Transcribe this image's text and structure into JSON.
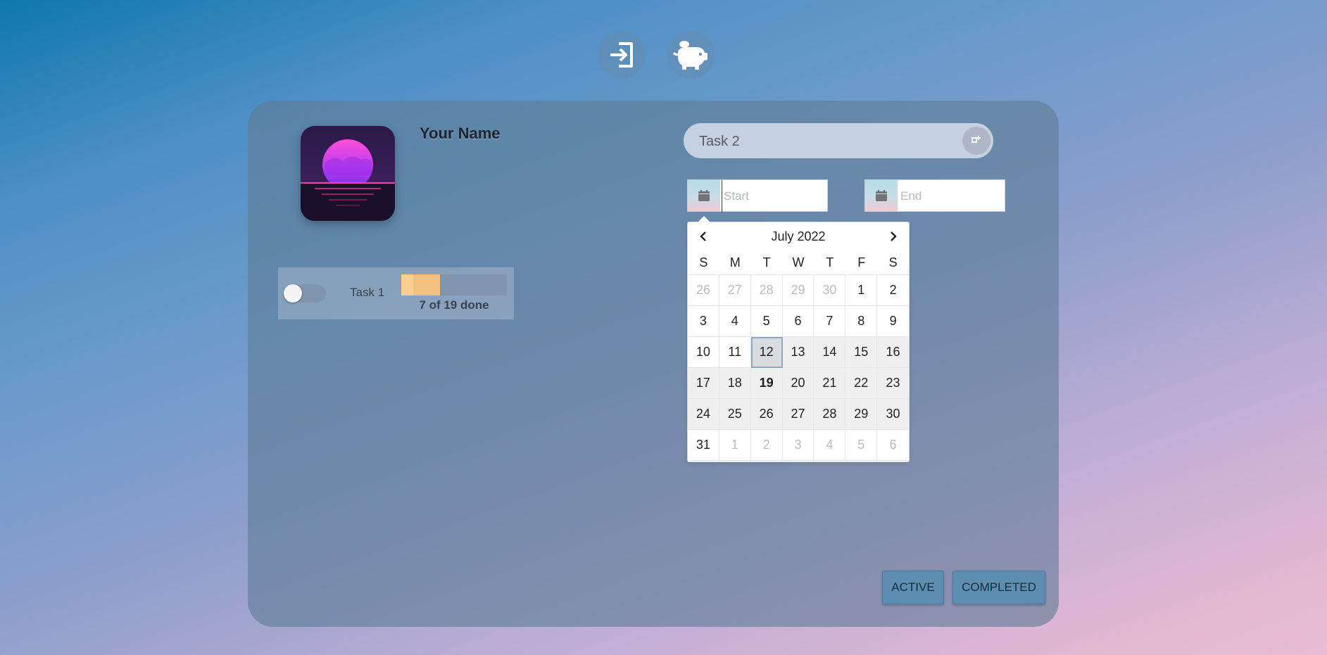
{
  "header": {
    "login_icon": "login-arrow-icon",
    "savings_icon": "piggy-bank-icon"
  },
  "profile": {
    "name": "Your Name",
    "avatar_icon": "synthwave-sunset-avatar"
  },
  "tasks": [
    {
      "name": "Task 1",
      "progress_text": "7 of 19 done",
      "progress_fraction": 0.368,
      "toggle_on": false
    }
  ],
  "new_task": {
    "value": "Task 2",
    "add_icon": "add-task-icon"
  },
  "date_range": {
    "start_placeholder": "Start",
    "end_placeholder": "End",
    "calendar_icon": "calendar-icon"
  },
  "datepicker": {
    "title": "July 2022",
    "prev_icon": "chevron-left-icon",
    "next_icon": "chevron-right-icon",
    "weekdays": [
      "S",
      "M",
      "T",
      "W",
      "T",
      "F",
      "S"
    ],
    "days": [
      {
        "label": "26",
        "muted": true
      },
      {
        "label": "27",
        "muted": true
      },
      {
        "label": "28",
        "muted": true
      },
      {
        "label": "29",
        "muted": true
      },
      {
        "label": "30",
        "muted": true
      },
      {
        "label": "1"
      },
      {
        "label": "2"
      },
      {
        "label": "3"
      },
      {
        "label": "4"
      },
      {
        "label": "5"
      },
      {
        "label": "6"
      },
      {
        "label": "7"
      },
      {
        "label": "8"
      },
      {
        "label": "9"
      },
      {
        "label": "10"
      },
      {
        "label": "11"
      },
      {
        "label": "12",
        "selected": true
      },
      {
        "label": "13",
        "inrange": true
      },
      {
        "label": "14",
        "inrange": true
      },
      {
        "label": "15",
        "inrange": true
      },
      {
        "label": "16",
        "inrange": true
      },
      {
        "label": "17",
        "inrange": true
      },
      {
        "label": "18",
        "inrange": true
      },
      {
        "label": "19",
        "inrange": true,
        "today": true
      },
      {
        "label": "20",
        "inrange": true
      },
      {
        "label": "21",
        "inrange": true
      },
      {
        "label": "22",
        "inrange": true
      },
      {
        "label": "23",
        "inrange": true
      },
      {
        "label": "24",
        "inrange": true
      },
      {
        "label": "25",
        "inrange": true
      },
      {
        "label": "26",
        "inrange": true
      },
      {
        "label": "27",
        "inrange": true
      },
      {
        "label": "28",
        "inrange": true
      },
      {
        "label": "29",
        "inrange": true
      },
      {
        "label": "30",
        "inrange": true
      },
      {
        "label": "31"
      },
      {
        "label": "1",
        "muted": true
      },
      {
        "label": "2",
        "muted": true
      },
      {
        "label": "3",
        "muted": true
      },
      {
        "label": "4",
        "muted": true
      },
      {
        "label": "5",
        "muted": true
      },
      {
        "label": "6",
        "muted": true
      }
    ]
  },
  "filters": {
    "active_label": "ACTIVE",
    "completed_label": "COMPLETED"
  },
  "colors": {
    "accent": "#5d8db0",
    "progress": "#f3c17f"
  }
}
